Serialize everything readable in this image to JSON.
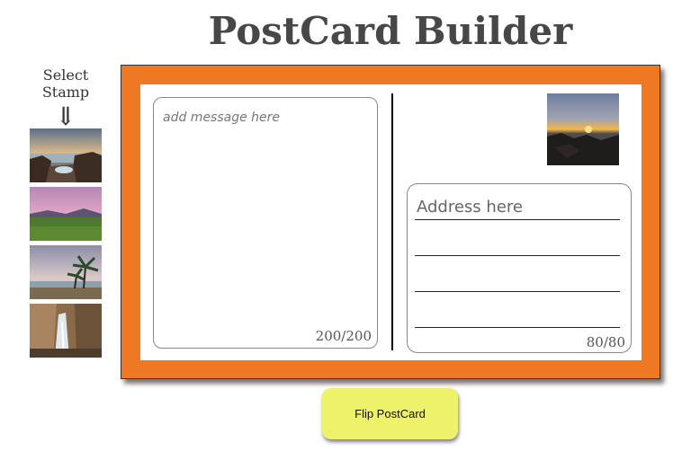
{
  "page": {
    "title": "PostCard Builder"
  },
  "stamp_picker": {
    "label": "Select Stamp",
    "arrow": "⇓",
    "stamps": [
      {
        "name": "sunset coast with rocks"
      },
      {
        "name": "pink sky over meadow"
      },
      {
        "name": "palm trees on beach"
      },
      {
        "name": "waterfall in canyon"
      }
    ]
  },
  "postcard": {
    "message": {
      "placeholder": "add message here",
      "counter": "200/200"
    },
    "address": {
      "placeholder": "Address here",
      "counter": "80/80"
    },
    "selected_stamp": "sunset coast with rocks",
    "colors": {
      "frame": "#ef7822",
      "button": "#eef26a"
    }
  },
  "actions": {
    "flip_label": "Flip PostCard"
  }
}
